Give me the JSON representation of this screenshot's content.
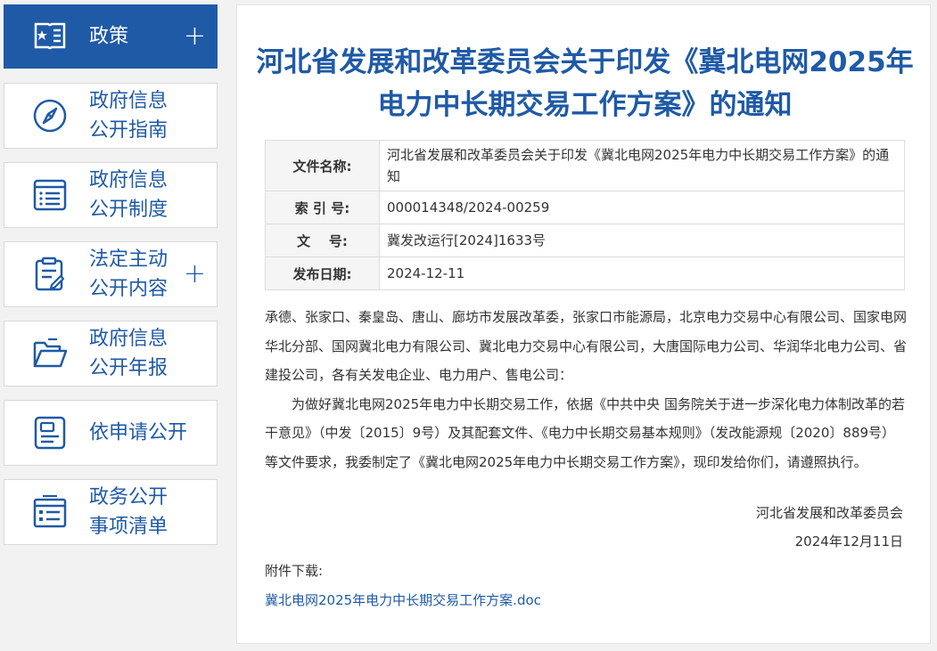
{
  "sidebar": {
    "items": [
      {
        "label": "政策",
        "icon": "policy-book-icon",
        "active": true,
        "expandable": true
      },
      {
        "label": "政府信息\n公开指南",
        "icon": "compass-icon",
        "active": false,
        "expandable": false
      },
      {
        "label": "政府信息\n公开制度",
        "icon": "list-document-icon",
        "active": false,
        "expandable": false
      },
      {
        "label": "法定主动\n公开内容",
        "icon": "clipboard-edit-icon",
        "active": false,
        "expandable": true
      },
      {
        "label": "政府信息\n公开年报",
        "icon": "folder-open-icon",
        "active": false,
        "expandable": false
      },
      {
        "label": "依申请公开",
        "icon": "application-form-icon",
        "active": false,
        "expandable": false
      },
      {
        "label": "政务公开\n事项清单",
        "icon": "checklist-icon",
        "active": false,
        "expandable": false
      }
    ],
    "plus_symbol": "+"
  },
  "document": {
    "title": "河北省发展和改革委员会关于印发《冀北电网2025年电力中长期交易工作方案》的通知",
    "meta": {
      "name_label": "文件名称:",
      "name_value": "河北省发展和改革委员会关于印发《冀北电网2025年电力中长期交易工作方案》的通知",
      "index_label": "索 引 号:",
      "index_value": "000014348/2024-00259",
      "doc_no_label": "文    号:",
      "doc_no_value": "冀发改运行[2024]1633号",
      "date_label": "发布日期:",
      "date_value": "2024-12-11"
    },
    "recipients": "承德、张家口、秦皇岛、唐山、廊坊市发展改革委，张家口市能源局，北京电力交易中心有限公司、国家电网华北分部、国网冀北电力有限公司、冀北电力交易中心有限公司，大唐国际电力公司、华润华北电力公司、省建投公司，各有关发电企业、电力用户、售电公司：",
    "body": "为做好冀北电网2025年电力中长期交易工作，依据《中共中央 国务院关于进一步深化电力体制改革的若干意见》（中发〔2015〕9号）及其配套文件、《电力中长期交易基本规则》（发改能源规〔2020〕889号）等文件要求，我委制定了《冀北电网2025年电力中长期交易工作方案》，现印发给你们，请遵照执行。",
    "signature_org": "河北省发展和改革委员会",
    "signature_date": "2024年12月11日",
    "attachment_label": "附件下载:",
    "attachment_link": "冀北电网2025年电力中长期交易工作方案.doc"
  },
  "colors": {
    "accent": "#1f5aa6",
    "background": "#f2f2f2"
  }
}
